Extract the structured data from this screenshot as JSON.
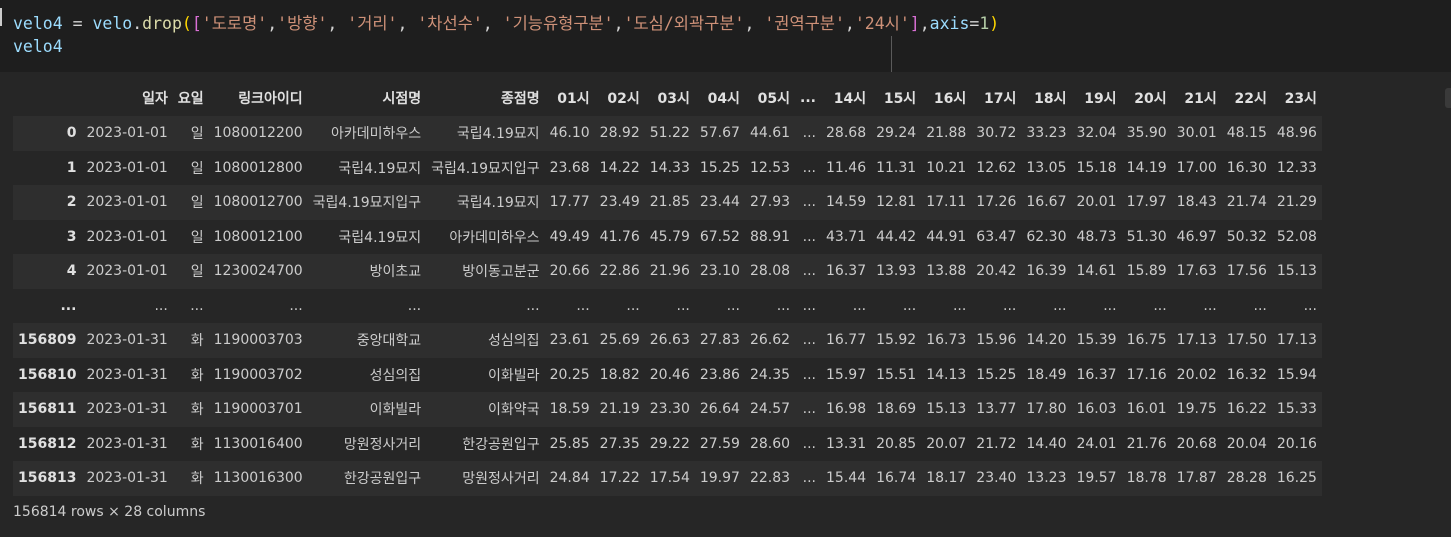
{
  "code": {
    "line1_prefix": "velo4 = velo.drop([",
    "drop_columns": [
      "'도로명'",
      "'방향'",
      "'거리'",
      "'차선수'",
      "'기능유형구분'",
      "'도심/외곽구분'",
      "'권역구분'",
      "'24시'"
    ],
    "line1_axis": "axis",
    "line1_axis_value": "1",
    "line2": "velo4"
  },
  "table": {
    "columns": [
      "일자",
      "요일",
      "링크아이디",
      "시점명",
      "종점명",
      "01시",
      "02시",
      "03시",
      "04시",
      "05시",
      "...",
      "14시",
      "15시",
      "16시",
      "17시",
      "18시",
      "19시",
      "20시",
      "21시",
      "22시",
      "23시"
    ],
    "rows": [
      {
        "index": "0",
        "cells": [
          "2023-01-01",
          "일",
          "1080012200",
          "아카데미하우스",
          "국립4.19묘지",
          "46.10",
          "28.92",
          "51.22",
          "57.67",
          "44.61",
          "...",
          "28.68",
          "29.24",
          "21.88",
          "30.72",
          "33.23",
          "32.04",
          "35.90",
          "30.01",
          "48.15",
          "48.96"
        ]
      },
      {
        "index": "1",
        "cells": [
          "2023-01-01",
          "일",
          "1080012800",
          "국립4.19묘지",
          "국립4.19묘지입구",
          "23.68",
          "14.22",
          "14.33",
          "15.25",
          "12.53",
          "...",
          "11.46",
          "11.31",
          "10.21",
          "12.62",
          "13.05",
          "15.18",
          "14.19",
          "17.00",
          "16.30",
          "12.33"
        ]
      },
      {
        "index": "2",
        "cells": [
          "2023-01-01",
          "일",
          "1080012700",
          "국립4.19묘지입구",
          "국립4.19묘지",
          "17.77",
          "23.49",
          "21.85",
          "23.44",
          "27.93",
          "...",
          "14.59",
          "12.81",
          "17.11",
          "17.26",
          "16.67",
          "20.01",
          "17.97",
          "18.43",
          "21.74",
          "21.29"
        ]
      },
      {
        "index": "3",
        "cells": [
          "2023-01-01",
          "일",
          "1080012100",
          "국립4.19묘지",
          "아카데미하우스",
          "49.49",
          "41.76",
          "45.79",
          "67.52",
          "88.91",
          "...",
          "43.71",
          "44.42",
          "44.91",
          "63.47",
          "62.30",
          "48.73",
          "51.30",
          "46.97",
          "50.32",
          "52.08"
        ]
      },
      {
        "index": "4",
        "cells": [
          "2023-01-01",
          "일",
          "1230024700",
          "방이초교",
          "방이동고분군",
          "20.66",
          "22.86",
          "21.96",
          "23.10",
          "28.08",
          "...",
          "16.37",
          "13.93",
          "13.88",
          "20.42",
          "16.39",
          "14.61",
          "15.89",
          "17.63",
          "17.56",
          "15.13"
        ]
      },
      {
        "index": "...",
        "cells": [
          "...",
          "...",
          "...",
          "...",
          "...",
          "...",
          "...",
          "...",
          "...",
          "...",
          "...",
          "...",
          "...",
          "...",
          "...",
          "...",
          "...",
          "...",
          "...",
          "...",
          "..."
        ]
      },
      {
        "index": "156809",
        "cells": [
          "2023-01-31",
          "화",
          "1190003703",
          "중앙대학교",
          "성심의집",
          "23.61",
          "25.69",
          "26.63",
          "27.83",
          "26.62",
          "...",
          "16.77",
          "15.92",
          "16.73",
          "15.96",
          "14.20",
          "15.39",
          "16.75",
          "17.13",
          "17.50",
          "17.13"
        ]
      },
      {
        "index": "156810",
        "cells": [
          "2023-01-31",
          "화",
          "1190003702",
          "성심의집",
          "이화빌라",
          "20.25",
          "18.82",
          "20.46",
          "23.86",
          "24.35",
          "...",
          "15.97",
          "15.51",
          "14.13",
          "15.25",
          "18.49",
          "16.37",
          "17.16",
          "20.02",
          "16.32",
          "15.94"
        ]
      },
      {
        "index": "156811",
        "cells": [
          "2023-01-31",
          "화",
          "1190003701",
          "이화빌라",
          "이화약국",
          "18.59",
          "21.19",
          "23.30",
          "26.64",
          "24.57",
          "...",
          "16.98",
          "18.69",
          "15.13",
          "13.77",
          "17.80",
          "16.03",
          "16.01",
          "19.75",
          "16.22",
          "15.33"
        ]
      },
      {
        "index": "156812",
        "cells": [
          "2023-01-31",
          "화",
          "1130016400",
          "망원정사거리",
          "한강공원입구",
          "25.85",
          "27.35",
          "29.22",
          "27.59",
          "28.60",
          "...",
          "13.31",
          "20.85",
          "20.07",
          "21.72",
          "14.40",
          "24.01",
          "21.76",
          "20.68",
          "20.04",
          "20.16"
        ]
      },
      {
        "index": "156813",
        "cells": [
          "2023-01-31",
          "화",
          "1130016300",
          "한강공원입구",
          "망원정사거리",
          "24.84",
          "17.22",
          "17.54",
          "19.97",
          "22.83",
          "...",
          "15.44",
          "16.74",
          "18.17",
          "23.40",
          "13.23",
          "19.57",
          "18.78",
          "17.87",
          "28.28",
          "16.25"
        ]
      }
    ]
  },
  "shape_text": "156814 rows × 28 columns",
  "colors": {
    "background": "#1f1f1f",
    "output_background": "#262626",
    "row_stripe": "#2e2e2e",
    "string": "#ce9178",
    "bracket_outer": "#ffd700",
    "bracket_inner": "#da70d6",
    "number": "#b5cea8"
  }
}
